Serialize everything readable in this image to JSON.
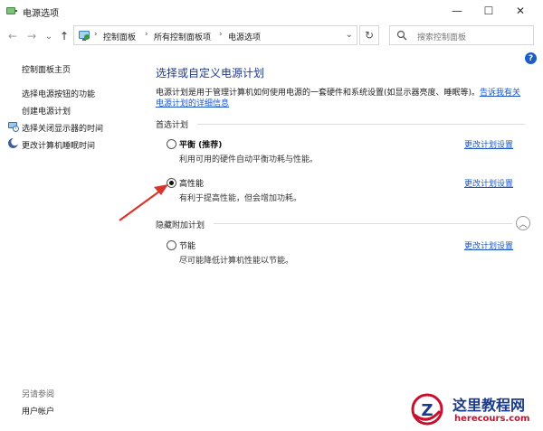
{
  "window": {
    "title": "电源选项",
    "minimize_glyph": "—",
    "maximize_glyph": "☐",
    "close_glyph": "✕"
  },
  "nav": {
    "back_glyph": "←",
    "forward_glyph": "→",
    "history_glyph": "⌄",
    "up_glyph": "↑",
    "breadcrumbs": [
      "控制面板",
      "所有控制面板项",
      "电源选项"
    ],
    "separator": "›",
    "dropdown_glyph": "⌄",
    "refresh_glyph": "↻",
    "search_placeholder": "搜索控制面板"
  },
  "sidebar": {
    "home": "控制面板主页",
    "items": [
      {
        "label": "选择电源按钮的功能",
        "icon": "none"
      },
      {
        "label": "创建电源计划",
        "icon": "none"
      },
      {
        "label": "选择关闭显示器的时间",
        "icon": "monitor-clock-icon"
      },
      {
        "label": "更改计算机睡眠时间",
        "icon": "moon-icon"
      }
    ],
    "see_also": "另请参阅",
    "user_accounts": "用户帐户"
  },
  "main": {
    "title": "选择或自定义电源计划",
    "description": "电源计划是用于管理计算机如何使用电源的一套硬件和系统设置(如显示器亮度、睡眠等)。",
    "description_link_1": "告诉我有关",
    "description_link_2": "电源计划的详细信息",
    "preferred_label": "首选计划",
    "hidden_label": "隐藏附加计划",
    "help_glyph": "?",
    "collapse_glyph": "︿",
    "plans": [
      {
        "name": "平衡 (推荐)",
        "desc": "利用可用的硬件自动平衡功耗与性能。",
        "link": "更改计划设置",
        "checked": false
      },
      {
        "name": "高性能",
        "desc": "有利于提高性能，但会增加功耗。",
        "link": "更改计划设置",
        "checked": true
      },
      {
        "name": "节能",
        "desc": "尽可能降低计算机性能以节能。",
        "link": "更改计划设置",
        "checked": false
      }
    ]
  },
  "watermark": {
    "title": "这里教程网",
    "url": "herecours.com",
    "logo_letter": "Z"
  },
  "colors": {
    "link": "#1a56c8",
    "title": "#1e3a8a",
    "arrow": "#d9362a",
    "watermark_blue": "#1a3a8c",
    "watermark_red": "#c8102e"
  }
}
